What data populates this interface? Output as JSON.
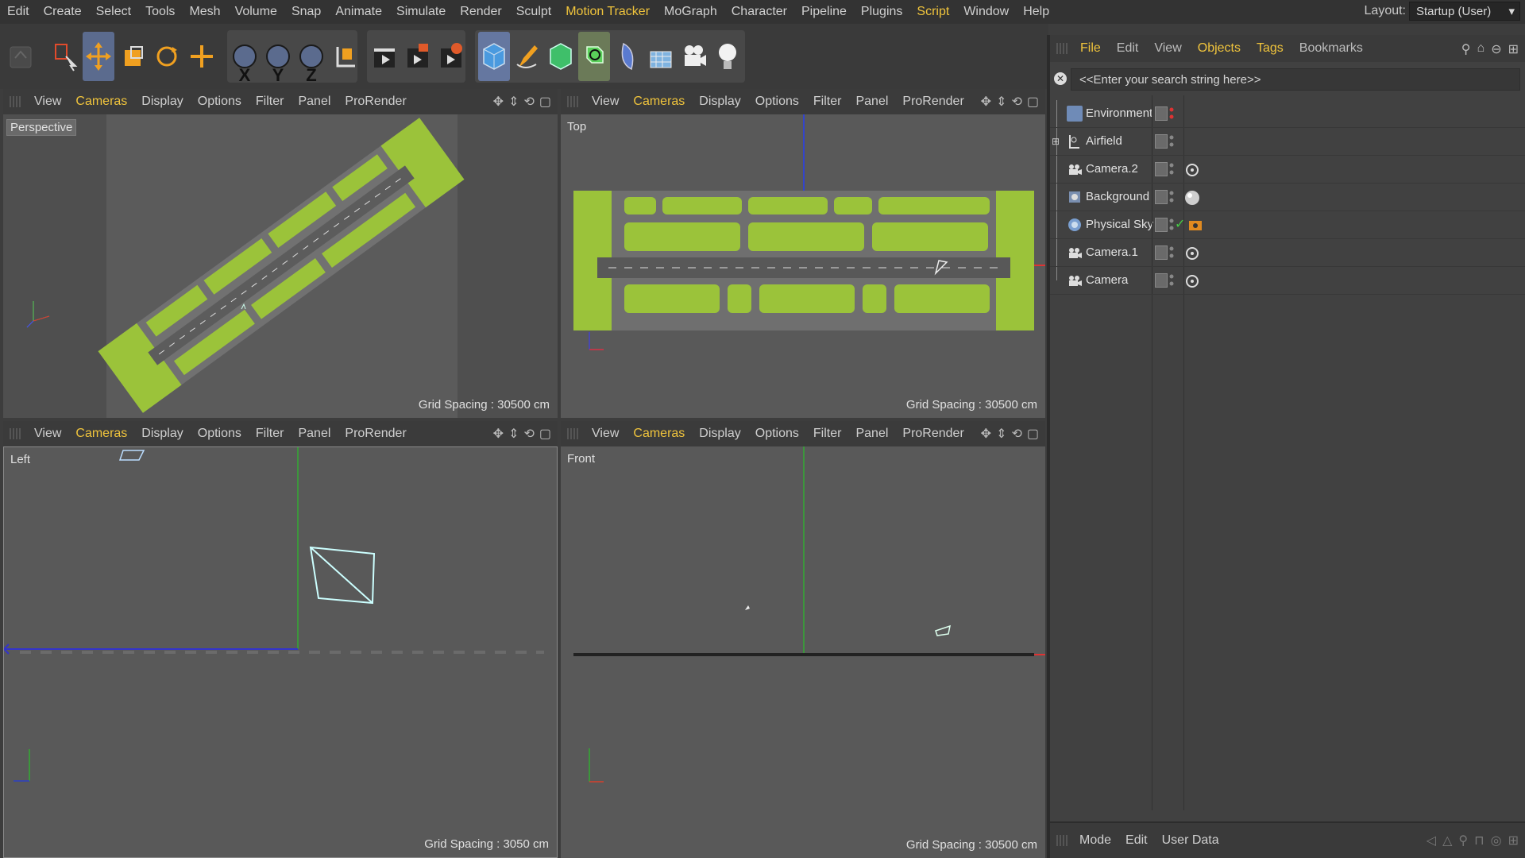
{
  "menubar": {
    "items": [
      {
        "label": "Edit",
        "highlight": false
      },
      {
        "label": "Create",
        "highlight": false
      },
      {
        "label": "Select",
        "highlight": false
      },
      {
        "label": "Tools",
        "highlight": false
      },
      {
        "label": "Mesh",
        "highlight": false
      },
      {
        "label": "Volume",
        "highlight": false
      },
      {
        "label": "Snap",
        "highlight": false
      },
      {
        "label": "Animate",
        "highlight": false
      },
      {
        "label": "Simulate",
        "highlight": false
      },
      {
        "label": "Render",
        "highlight": false
      },
      {
        "label": "Sculpt",
        "highlight": false
      },
      {
        "label": "Motion Tracker",
        "highlight": true
      },
      {
        "label": "MoGraph",
        "highlight": false
      },
      {
        "label": "Character",
        "highlight": false
      },
      {
        "label": "Pipeline",
        "highlight": false
      },
      {
        "label": "Plugins",
        "highlight": false
      },
      {
        "label": "Script",
        "highlight": true
      },
      {
        "label": "Window",
        "highlight": false
      },
      {
        "label": "Help",
        "highlight": false
      }
    ],
    "layout_label": "Layout:",
    "layout_value": "Startup (User)"
  },
  "toolbar": {
    "icons": [
      "undo-icon",
      "live-select-icon",
      "move-icon",
      "scale-icon",
      "rotate-icon",
      "add-object-icon",
      "x-axis-icon",
      "y-axis-icon",
      "z-axis-icon",
      "coordinate-system-icon",
      "render-view-icon",
      "render-to-picture-viewer-icon",
      "render-settings-icon",
      "cube-icon",
      "pen-icon",
      "subdivision-icon",
      "array-icon",
      "deformer-icon",
      "floor-icon",
      "camera-icon",
      "light-icon"
    ],
    "axis_labels": [
      "X",
      "Y",
      "Z"
    ]
  },
  "viewports": [
    {
      "name": "Perspective",
      "grid": "Grid Spacing : 30500 cm"
    },
    {
      "name": "Top",
      "grid": "Grid Spacing : 30500 cm"
    },
    {
      "name": "Left",
      "grid": "Grid Spacing : 3050 cm"
    },
    {
      "name": "Front",
      "grid": "Grid Spacing : 30500 cm"
    }
  ],
  "viewport_menu": [
    "View",
    "Cameras",
    "Display",
    "Options",
    "Filter",
    "Panel",
    "ProRender"
  ],
  "object_manager": {
    "menu": [
      {
        "label": "File",
        "highlight": false
      },
      {
        "label": "Edit",
        "highlight": false
      },
      {
        "label": "View",
        "highlight": false
      },
      {
        "label": "Objects",
        "highlight": true
      },
      {
        "label": "Tags",
        "highlight": true
      },
      {
        "label": "Bookmarks",
        "highlight": false
      }
    ],
    "search_placeholder": "<<Enter your search string here>>",
    "objects": [
      {
        "name": "Environment",
        "icon": "environment-icon",
        "tag": ""
      },
      {
        "name": "Airfield",
        "icon": "null-object-icon",
        "tag": ""
      },
      {
        "name": "Camera.2",
        "icon": "camera-icon",
        "tag": "target-tag-icon"
      },
      {
        "name": "Background",
        "icon": "background-icon",
        "tag": "material-tag-icon"
      },
      {
        "name": "Physical Sky",
        "icon": "sky-icon",
        "tag": "sky-tag-icon"
      },
      {
        "name": "Camera.1",
        "icon": "camera-icon",
        "tag": "target-tag-icon"
      },
      {
        "name": "Camera",
        "icon": "camera-icon",
        "tag": "target-tag-icon"
      }
    ]
  },
  "attribute_bar": {
    "items": [
      "Mode",
      "Edit",
      "User Data"
    ]
  },
  "colors": {
    "accent": "#f0c43c",
    "panel": "#414141",
    "viewport": "#595959",
    "grass": "#9bc33a",
    "runway": "#6e6e6e"
  }
}
